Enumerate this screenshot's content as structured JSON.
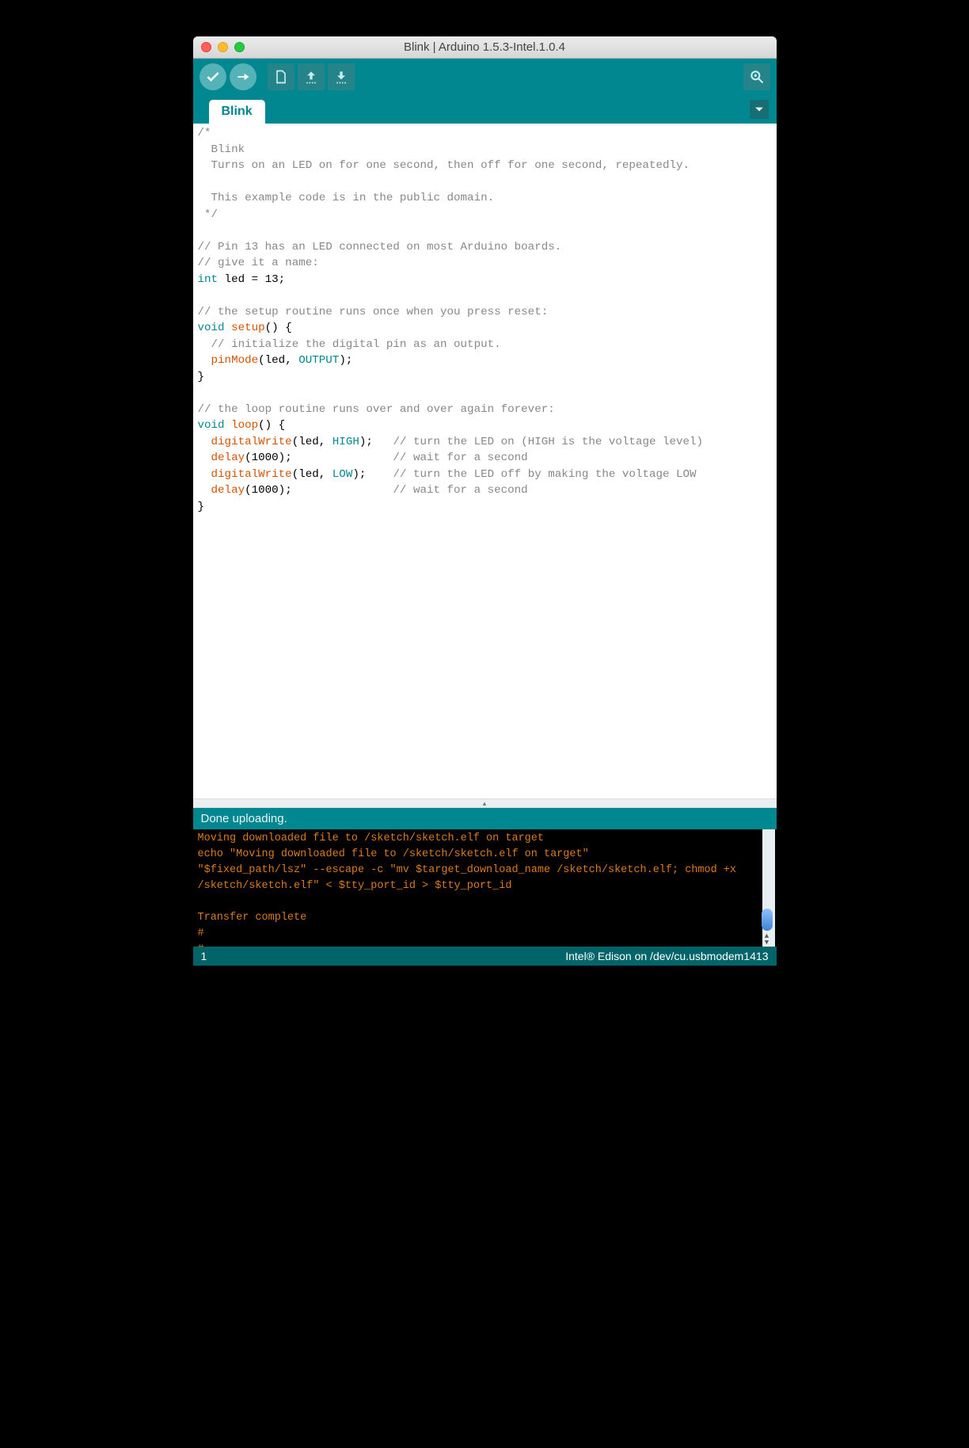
{
  "window": {
    "title": "Blink | Arduino 1.5.3-Intel.1.0.4"
  },
  "tab": {
    "name": "Blink"
  },
  "code": {
    "l01": "/*",
    "l02": "  Blink",
    "l03": "  Turns on an LED on for one second, then off for one second, repeatedly.",
    "l04_blank": " ",
    "l05": "  This example code is in the public domain.",
    "l06": " */",
    "l07_blank": "",
    "l08": "// Pin 13 has an LED connected on most Arduino boards.",
    "l09": "// give it a name:",
    "l10_int": "int",
    "l10_rest": " led = 13;",
    "l11_blank": "",
    "l12": "// the setup routine runs once when you press reset:",
    "l13_void": "void",
    "l13_sp": " ",
    "l13_setup": "setup",
    "l13_rest": "() {",
    "l14": "  // initialize the digital pin as an output.",
    "l15_ind": "  ",
    "l15_pinmode": "pinMode",
    "l15_open": "(led, ",
    "l15_output": "OUTPUT",
    "l15_close": ");",
    "l16": "}",
    "l17_blank": "",
    "l18": "// the loop routine runs over and over again forever:",
    "l19_void": "void",
    "l19_sp": " ",
    "l19_loop": "loop",
    "l19_rest": "() {",
    "l20_ind": "  ",
    "l20_dw": "digitalWrite",
    "l20_open": "(led, ",
    "l20_high": "HIGH",
    "l20_close": ");   ",
    "l20_cmt": "// turn the LED on (HIGH is the voltage level)",
    "l21_ind": "  ",
    "l21_delay": "delay",
    "l21_args": "(1000);               ",
    "l21_cmt": "// wait for a second",
    "l22_ind": "  ",
    "l22_dw": "digitalWrite",
    "l22_open": "(led, ",
    "l22_low": "LOW",
    "l22_close": ");    ",
    "l22_cmt": "// turn the LED off by making the voltage LOW",
    "l23_ind": "  ",
    "l23_delay": "delay",
    "l23_args": "(1000);               ",
    "l23_cmt": "// wait for a second",
    "l24": "}"
  },
  "status": {
    "message": "Done uploading."
  },
  "console": {
    "line1": "Moving downloaded file to /sketch/sketch.elf on target",
    "line2": "echo \"Moving downloaded file to /sketch/sketch.elf on target\"",
    "line3": "\"$fixed_path/lsz\" --escape -c \"mv $target_download_name /sketch/sketch.elf; chmod +x /sketch/sketch.elf\" < $tty_port_id > $tty_port_id",
    "line4": "",
    "line5": "Transfer complete",
    "line6": "#",
    "line7": "#"
  },
  "bottom": {
    "line": "1",
    "board": "Intel® Edison on /dev/cu.usbmodem1413"
  },
  "grabber_glyph": "▴"
}
